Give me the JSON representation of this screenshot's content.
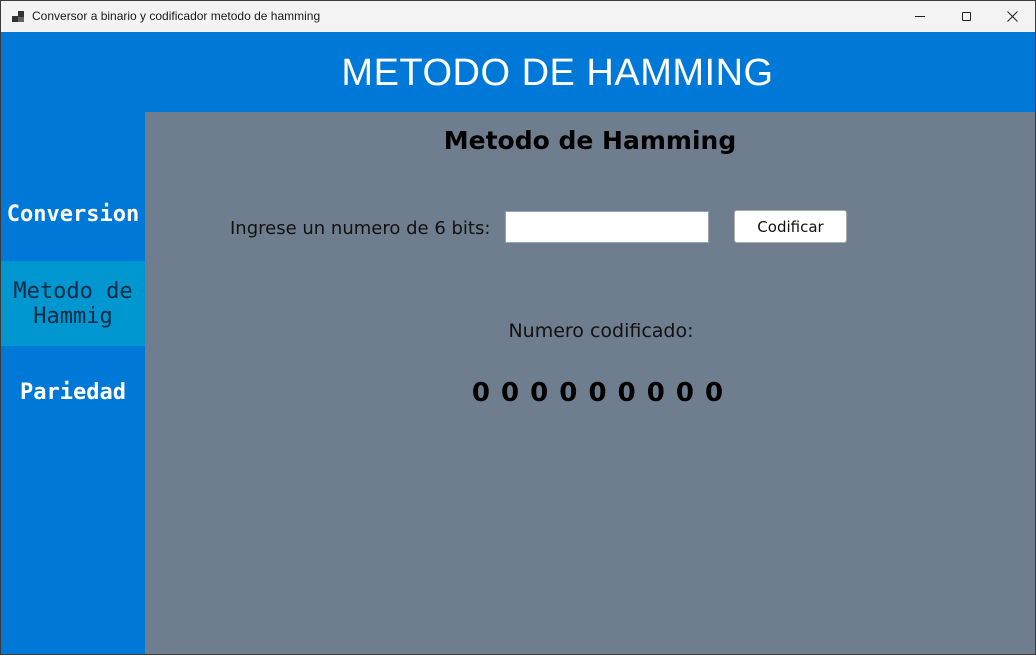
{
  "window": {
    "title": "Conversor a binario y codificador metodo de hamming",
    "controls": [
      "minimize-icon",
      "maximize-icon",
      "close-icon"
    ]
  },
  "header": {
    "title": "METODO DE HAMMING"
  },
  "sidebar": {
    "items": [
      {
        "label": "Conversion",
        "active": false
      },
      {
        "label": "Metodo de Hammig",
        "active": true
      },
      {
        "label": "Pariedad",
        "active": false
      }
    ]
  },
  "main": {
    "title": "Metodo de Hamming",
    "input_label": "Ingrese un numero de 6 bits:",
    "input_value": "",
    "encode_button": "Codificar",
    "result_label": "Numero codificado:",
    "result_value": "0 0 0 0 0 0 0 0 0"
  },
  "colors": {
    "accent_blue": "#0078d7",
    "active_nav": "#0096cf",
    "panel_gray": "#6f7e8e",
    "titlebar": "#f3f3f3"
  }
}
